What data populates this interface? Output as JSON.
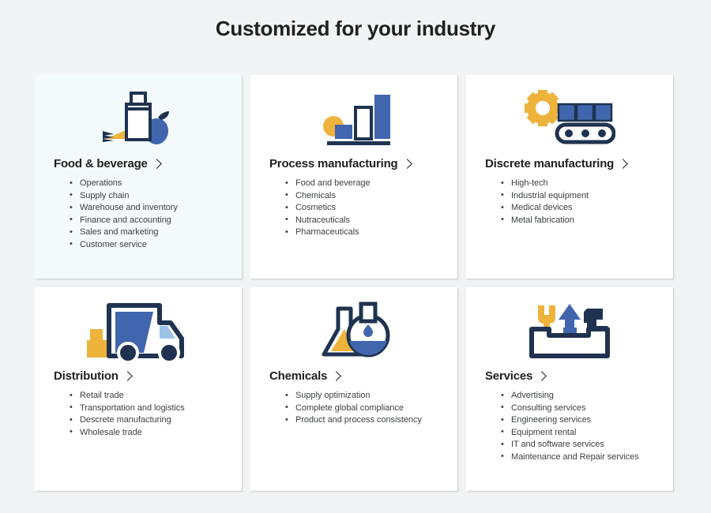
{
  "header": {
    "title": "Customized for your industry"
  },
  "colors": {
    "page_background": "#f2f3f4",
    "card_background": "#ffffff",
    "card_highlight_background": "#f4f9fc",
    "brand_blue": "#4166ae",
    "brand_light_blue": "#9cc2e8",
    "brand_yellow": "#eeb33b",
    "brand_dark": "#1f3council"
  },
  "cards": [
    {
      "icon": "milk-carton-apple-wheat-icon",
      "title": "Food & beverage",
      "highlighted": true,
      "items": [
        "Operations",
        "Supply chain",
        "Warehouse and inventory",
        "Finance and accounting",
        "Sales and marketing",
        "Customer service"
      ]
    },
    {
      "icon": "bar-chart-icon",
      "title": "Process manufacturing",
      "highlighted": false,
      "items": [
        "Food and beverage",
        "Chemicals",
        "Cosmetics",
        "Nutraceuticals",
        "Pharmaceuticals"
      ]
    },
    {
      "icon": "gear-conveyor-belt-icon",
      "title": "Discrete manufacturing",
      "highlighted": false,
      "items": [
        "High-tech",
        "Industrial equipment",
        "Medical devices",
        "Metal fabrication"
      ]
    },
    {
      "icon": "delivery-truck-icon",
      "title": "Distribution",
      "highlighted": false,
      "items": [
        "Retail trade",
        "Transportation and logistics",
        "Descrete manufacturing",
        "Wholesale trade"
      ]
    },
    {
      "icon": "lab-flask-beaker-icon",
      "title": "Chemicals",
      "highlighted": false,
      "items": [
        "Supply optimization",
        "Complete global compliance",
        "Product and process consistency"
      ]
    },
    {
      "icon": "toolbox-tools-icon",
      "title": "Services",
      "highlighted": false,
      "items": [
        "Advertising",
        "Consulting services",
        "Engineering services",
        "Equipment rental",
        "IT and software services",
        "Maintenance and Repair services"
      ]
    }
  ]
}
